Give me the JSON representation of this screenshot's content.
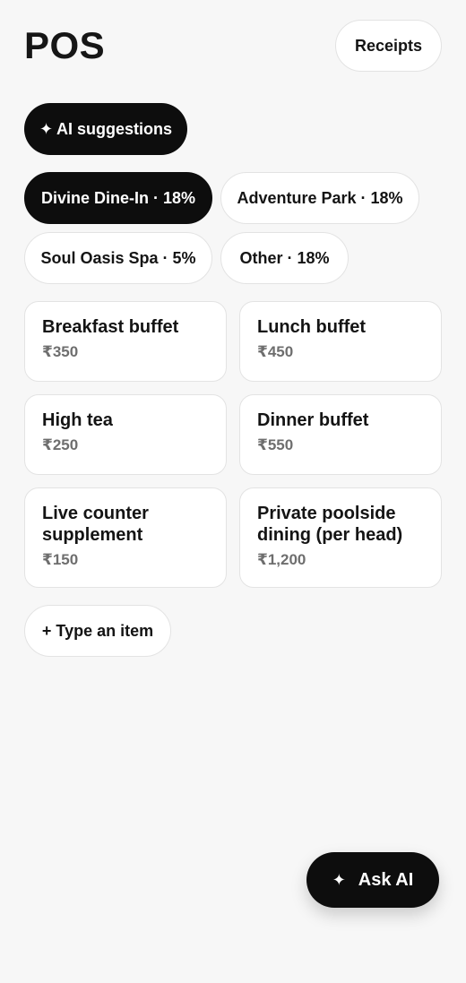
{
  "header": {
    "title": "POS",
    "receipts_label": "Receipts"
  },
  "ai_suggestions": {
    "icon": "sparkle-icon",
    "icon_glyph": "✦",
    "label": "AI suggestions"
  },
  "categories": [
    {
      "label": "Divine Dine-In · 18%",
      "active": true
    },
    {
      "label": "Adventure Park · 18%",
      "active": false
    },
    {
      "label": "Soul Oasis Spa · 5%",
      "active": false
    },
    {
      "label": "Other · 18%",
      "active": false
    }
  ],
  "items": [
    {
      "name": "Breakfast buffet",
      "price": "₹350"
    },
    {
      "name": "Lunch buffet",
      "price": "₹450"
    },
    {
      "name": "High tea",
      "price": "₹250"
    },
    {
      "name": "Dinner buffet",
      "price": "₹550"
    },
    {
      "name": "Live counter supplement",
      "price": "₹150"
    },
    {
      "name": "Private poolside dining (per head)",
      "price": "₹1,200"
    }
  ],
  "type_item_label": "+ Type an item",
  "ask_ai": {
    "icon": "sparkle-icon",
    "icon_glyph": "✦",
    "label": "Ask AI"
  },
  "colors": {
    "background": "#f7f7f7",
    "primary": "#0d0d0d",
    "surface": "#ffffff",
    "muted_text": "#6e6e6e"
  }
}
